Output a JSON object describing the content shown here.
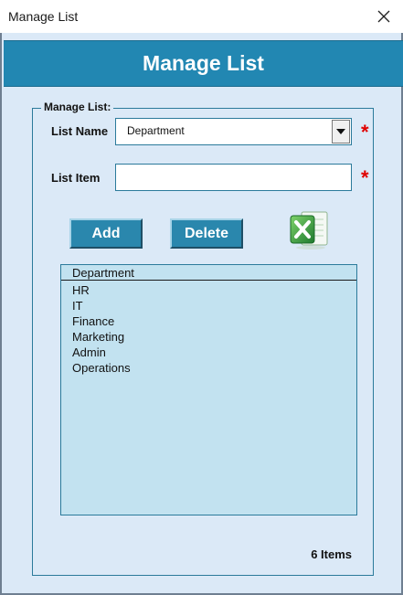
{
  "window": {
    "title": "Manage List",
    "close_icon": "close-icon"
  },
  "header": {
    "title": "Manage List"
  },
  "frame": {
    "legend": "Manage List:"
  },
  "form": {
    "list_name_label": "List Name",
    "list_name_value": "Department",
    "list_item_label": "List Item",
    "list_item_value": "",
    "required_marker": "*"
  },
  "buttons": {
    "add": "Add",
    "delete": "Delete",
    "export_icon": "excel-icon"
  },
  "list": {
    "column_header": "Department",
    "items": [
      "HR",
      "IT",
      "Finance",
      "Marketing",
      "Admin",
      "Operations"
    ]
  },
  "status": {
    "count_text": "6 Items"
  },
  "colors": {
    "header_bg": "#2287b2",
    "form_bg": "#dbe9f7",
    "list_bg": "#c2e2f0",
    "button_bg": "#2a87ad",
    "required": "#e00000"
  }
}
